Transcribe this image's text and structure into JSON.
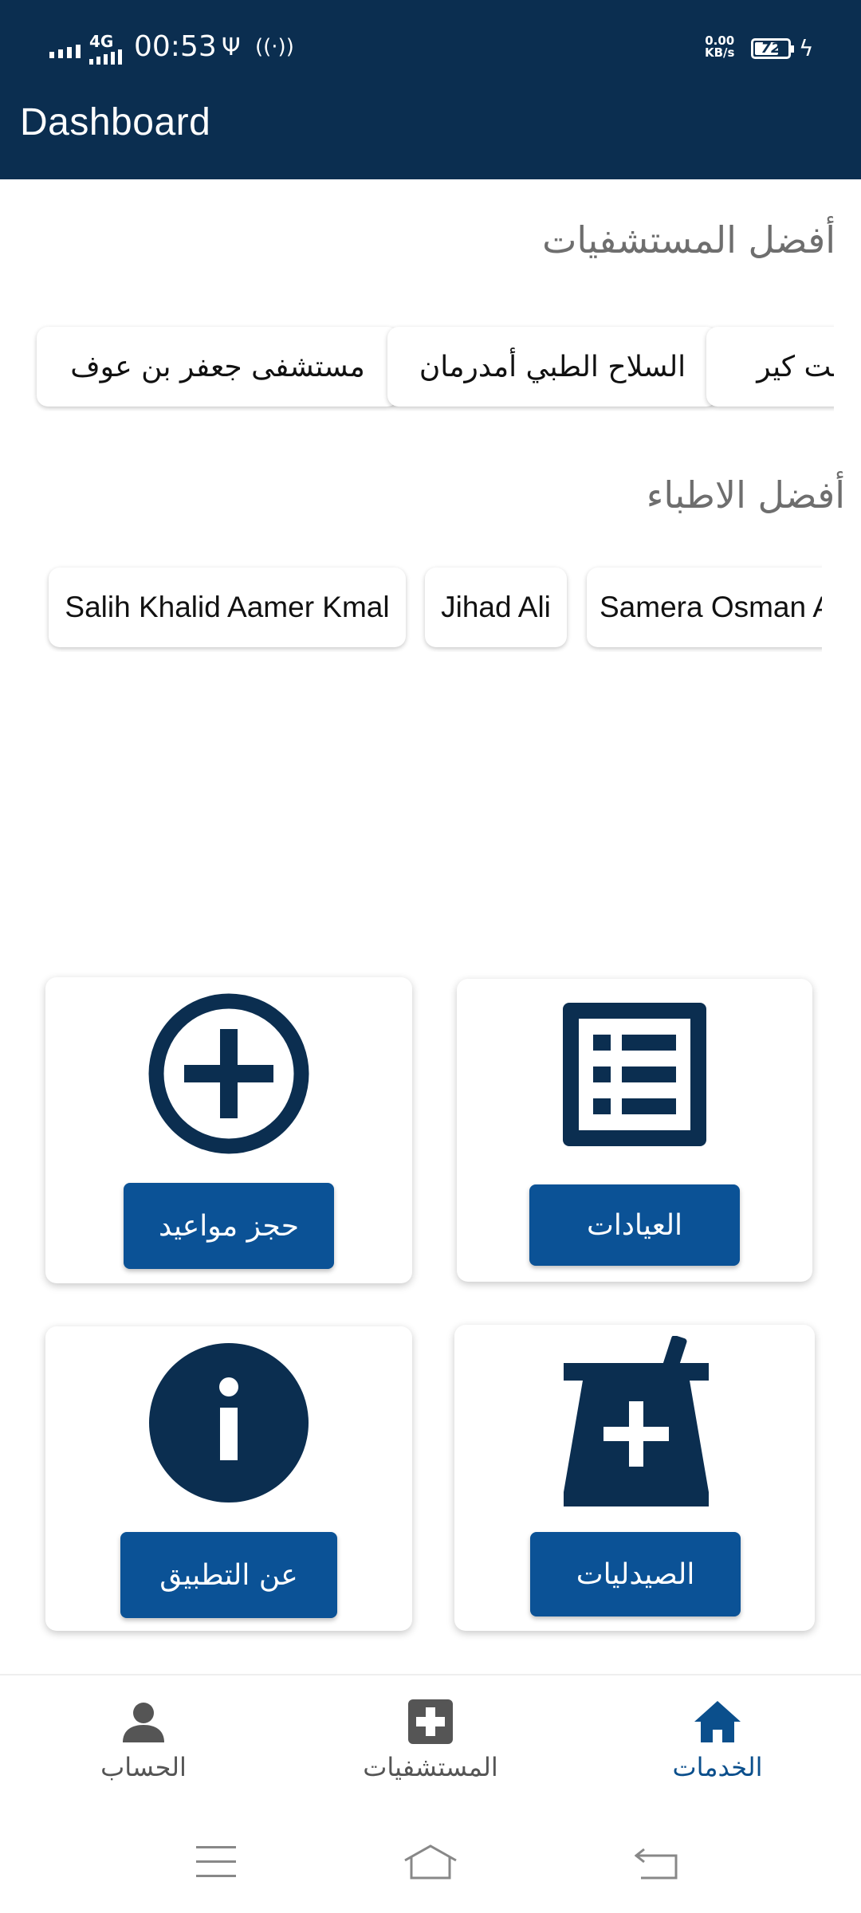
{
  "status_bar": {
    "network": "4G",
    "time": "00:53",
    "speed_value": "0.00",
    "speed_unit": "KB/s",
    "battery": "72",
    "battery_level": 0.72
  },
  "app_bar": {
    "title": "Dashboard"
  },
  "hospitals": {
    "title": "أفضل المستشفيات",
    "items": [
      "مستشفى جعفر بن عوف",
      "السلاح الطبي أمدرمان",
      "بست كير"
    ]
  },
  "doctors": {
    "title": "أفضل الاطباء",
    "items": [
      "Salih Khalid Aamer Kmal",
      "Jihad Ali",
      "Samera Osman A"
    ]
  },
  "services": {
    "booking": {
      "label": "حجز مواعيد",
      "icon": "plus-circle-icon"
    },
    "clinics": {
      "label": "العيادات",
      "icon": "list-icon"
    },
    "about": {
      "label": "عن التطبيق",
      "icon": "info-icon"
    },
    "pharmacies": {
      "label": "الصيدليات",
      "icon": "mortar-pestle-plus-icon"
    }
  },
  "bottom_nav": {
    "account": {
      "label": "الحساب",
      "icon": "person-icon"
    },
    "hospitals": {
      "label": "المستشفيات",
      "icon": "medical-cross-icon"
    },
    "services": {
      "label": "الخدمات",
      "icon": "home-icon",
      "active": true
    }
  },
  "colors": {
    "primary_dark": "#0b2e50",
    "button_blue": "#0b5296",
    "active_nav": "#0b4f8c"
  }
}
